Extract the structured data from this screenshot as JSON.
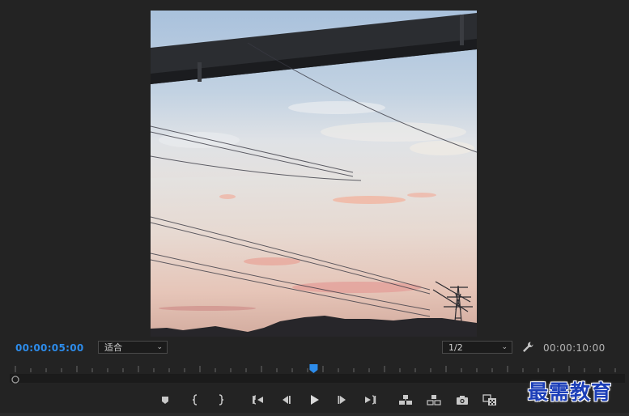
{
  "playback": {
    "current_time": "00:00:05:00",
    "duration": "00:00:10:00",
    "zoom_value": "适合",
    "resolution_value": "1/2",
    "playhead_fraction": 0.494
  },
  "icons": {
    "wrench": "wrench-icon",
    "add_marker": "marker-icon",
    "mark_in": "mark-in-icon",
    "mark_out": "mark-out-icon",
    "go_to_in": "go-to-in-icon",
    "step_back": "step-back-icon",
    "play": "play-icon",
    "step_forward": "step-forward-icon",
    "go_to_out": "go-to-out-icon",
    "lift": "lift-icon",
    "extract": "extract-icon",
    "export_frame": "camera-icon",
    "compare": "compare-view-icon"
  },
  "colors": {
    "timecode_accent": "#2d8ceb",
    "panel_bg": "#232323",
    "playhead": "#2d8ceb"
  },
  "watermark": {
    "text": "最需教育"
  }
}
